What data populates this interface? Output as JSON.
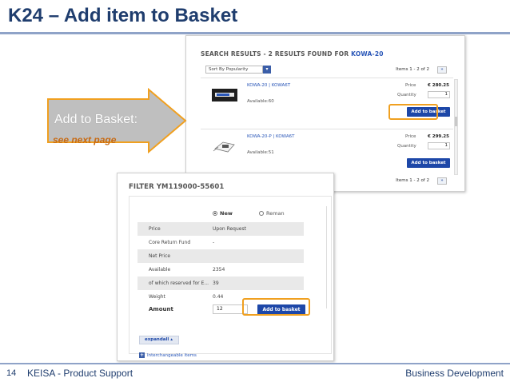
{
  "slide": {
    "title": "K24 – Add item to Basket",
    "page_number": "14",
    "footer_left": "KEISA - Product Support",
    "footer_right": "Business Development"
  },
  "callout": {
    "title": "Add to Basket:",
    "subtitle": "see next page",
    "fill_color": "#bfbfbf",
    "stroke_color": "#f0a020",
    "text_color": "#c86a12"
  },
  "search_results": {
    "heading_prefix": "SEARCH RESULTS - 2 RESULTS FOUND FOR",
    "heading_query": "KOWA-20",
    "sort_label": "Sort By Popularity",
    "items_top": "Items 1 - 2 of 2",
    "items_bottom": "Items 1 - 2 of 2",
    "pager_label": "»",
    "items": [
      {
        "part": "KOWA-20 | KOWA6T",
        "available": "Available:60",
        "price_label": "Price",
        "price": "€ 280.25",
        "qty_label": "Quantity",
        "qty": "1",
        "button": "Add to basket"
      },
      {
        "part": "KOWA-20-P | KOWA6T",
        "available": "Available:51",
        "price_label": "Price",
        "price": "€ 299.25",
        "qty_label": "Quantity",
        "qty": "1",
        "button": "Add to basket"
      }
    ]
  },
  "filter": {
    "title": "FILTER YM119000-55601",
    "radio_new": "New",
    "radio_reman": "Reman",
    "rows": [
      {
        "key": "Price",
        "value": "Upon Request",
        "shaded": true
      },
      {
        "key": "Core Return Fund",
        "value": "-",
        "shaded": false
      },
      {
        "key": "Net Price",
        "value": "",
        "shaded": true
      },
      {
        "key": "Available",
        "value": "2354",
        "shaded": false
      },
      {
        "key": "of which reserved for E...",
        "value": "39",
        "shaded": true
      },
      {
        "key": "Weight",
        "value": "0.44",
        "shaded": false
      }
    ],
    "amount_label": "Amount",
    "amount_value": "12",
    "button": "Add to basket",
    "expand_label": "expandall",
    "interchangeable_label": "Interchangeable items"
  },
  "colors": {
    "title_blue": "#1f3d6e",
    "button_blue": "#1d47a8",
    "highlight_orange": "#f0a020"
  }
}
